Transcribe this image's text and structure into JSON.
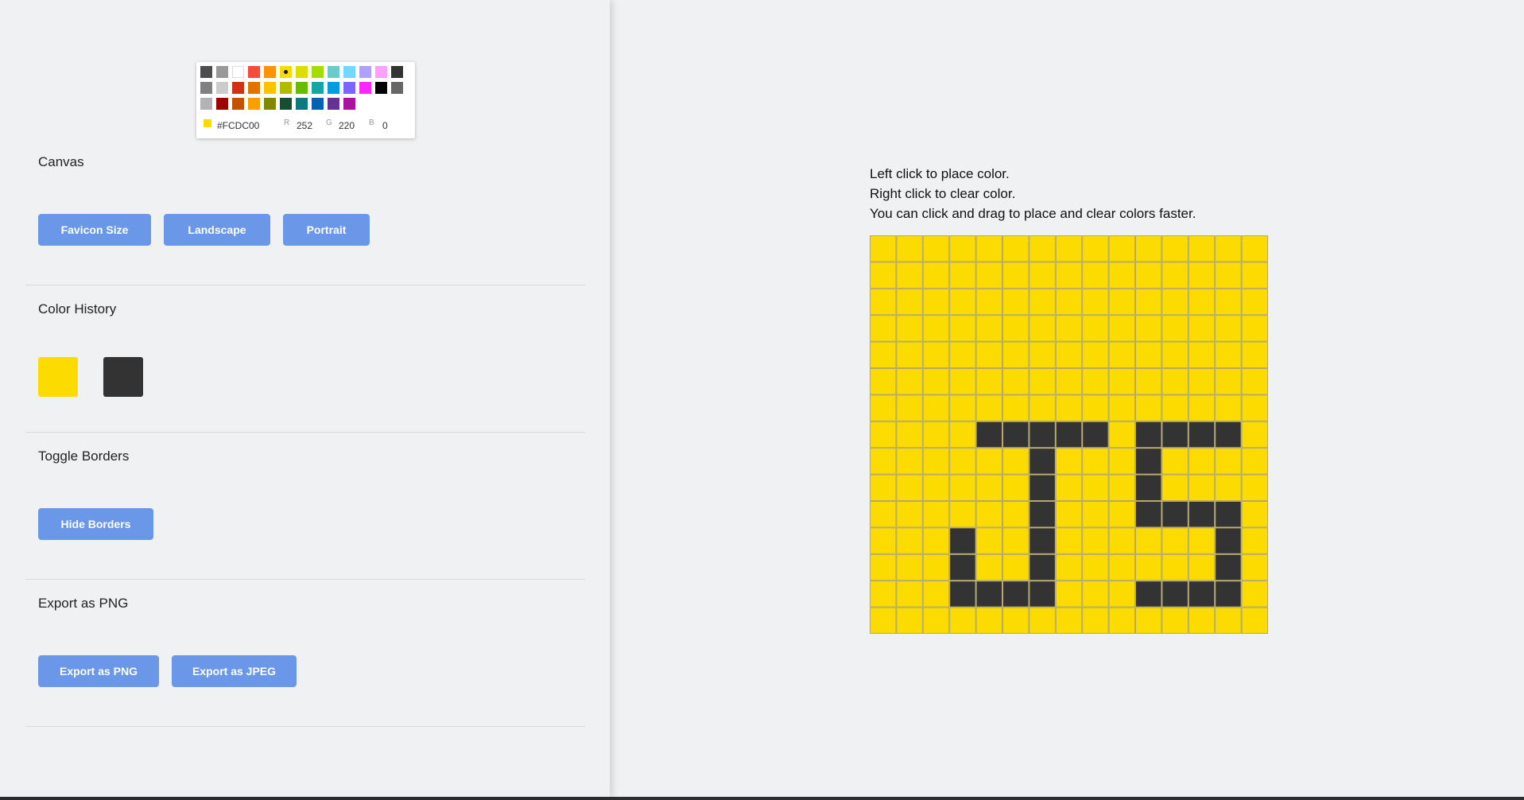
{
  "picker": {
    "palette": [
      "#4D4D4D",
      "#999999",
      "#FFFFFF",
      "#F44E3B",
      "#FE9200",
      "#FCDC00",
      "#DBDF00",
      "#A4DD00",
      "#68CCCA",
      "#73D8FF",
      "#AEA1FF",
      "#FDA1FF",
      "#333333",
      "#808080",
      "#CCCCCC",
      "#D33115",
      "#E27300",
      "#FCC400",
      "#B0BC00",
      "#68BC00",
      "#16A5A5",
      "#009CE0",
      "#7B64FF",
      "#FA28FF",
      "#000000",
      "#666666",
      "#B3B3B3",
      "#9F0500",
      "#C45100",
      "#FB9E00",
      "#808900",
      "#194D33",
      "#0C797D",
      "#0062B1",
      "#653294",
      "#AB149E"
    ],
    "selected_index": 5,
    "current_color": "#FCDC00",
    "hex_label": "#FCDC00",
    "r_label": "R",
    "r_value": "252",
    "g_label": "G",
    "g_value": "220",
    "b_label": "B",
    "b_value": "0"
  },
  "canvas_section": {
    "title": "Canvas",
    "buttons": [
      "Favicon Size",
      "Landscape",
      "Portrait"
    ]
  },
  "history_section": {
    "title": "Color History",
    "colors": [
      "#FCDC00",
      "#333333"
    ]
  },
  "borders_section": {
    "title": "Toggle Borders",
    "button": "Hide Borders"
  },
  "export_section": {
    "title": "Export as PNG",
    "buttons": [
      "Export as PNG",
      "Export as JPEG"
    ]
  },
  "instructions": [
    "Left click to place color.",
    "Right click to clear color.",
    "You can click and drag to place and clear colors faster."
  ],
  "pixel_grid": {
    "columns": 15,
    "rows": 15,
    "fill_color": "#FCDC00",
    "ink_color": "#333333",
    "border_color": "#B5A86A",
    "ink_cells": [
      [
        7,
        4
      ],
      [
        7,
        5
      ],
      [
        7,
        6
      ],
      [
        7,
        7
      ],
      [
        7,
        8
      ],
      [
        7,
        10
      ],
      [
        7,
        11
      ],
      [
        7,
        12
      ],
      [
        7,
        13
      ],
      [
        8,
        6
      ],
      [
        8,
        10
      ],
      [
        9,
        6
      ],
      [
        9,
        10
      ],
      [
        10,
        6
      ],
      [
        10,
        10
      ],
      [
        10,
        11
      ],
      [
        10,
        12
      ],
      [
        10,
        13
      ],
      [
        11,
        3
      ],
      [
        11,
        6
      ],
      [
        11,
        13
      ],
      [
        12,
        3
      ],
      [
        12,
        6
      ],
      [
        12,
        13
      ],
      [
        13,
        3
      ],
      [
        13,
        4
      ],
      [
        13,
        5
      ],
      [
        13,
        6
      ],
      [
        13,
        10
      ],
      [
        13,
        11
      ],
      [
        13,
        12
      ],
      [
        13,
        13
      ]
    ]
  }
}
